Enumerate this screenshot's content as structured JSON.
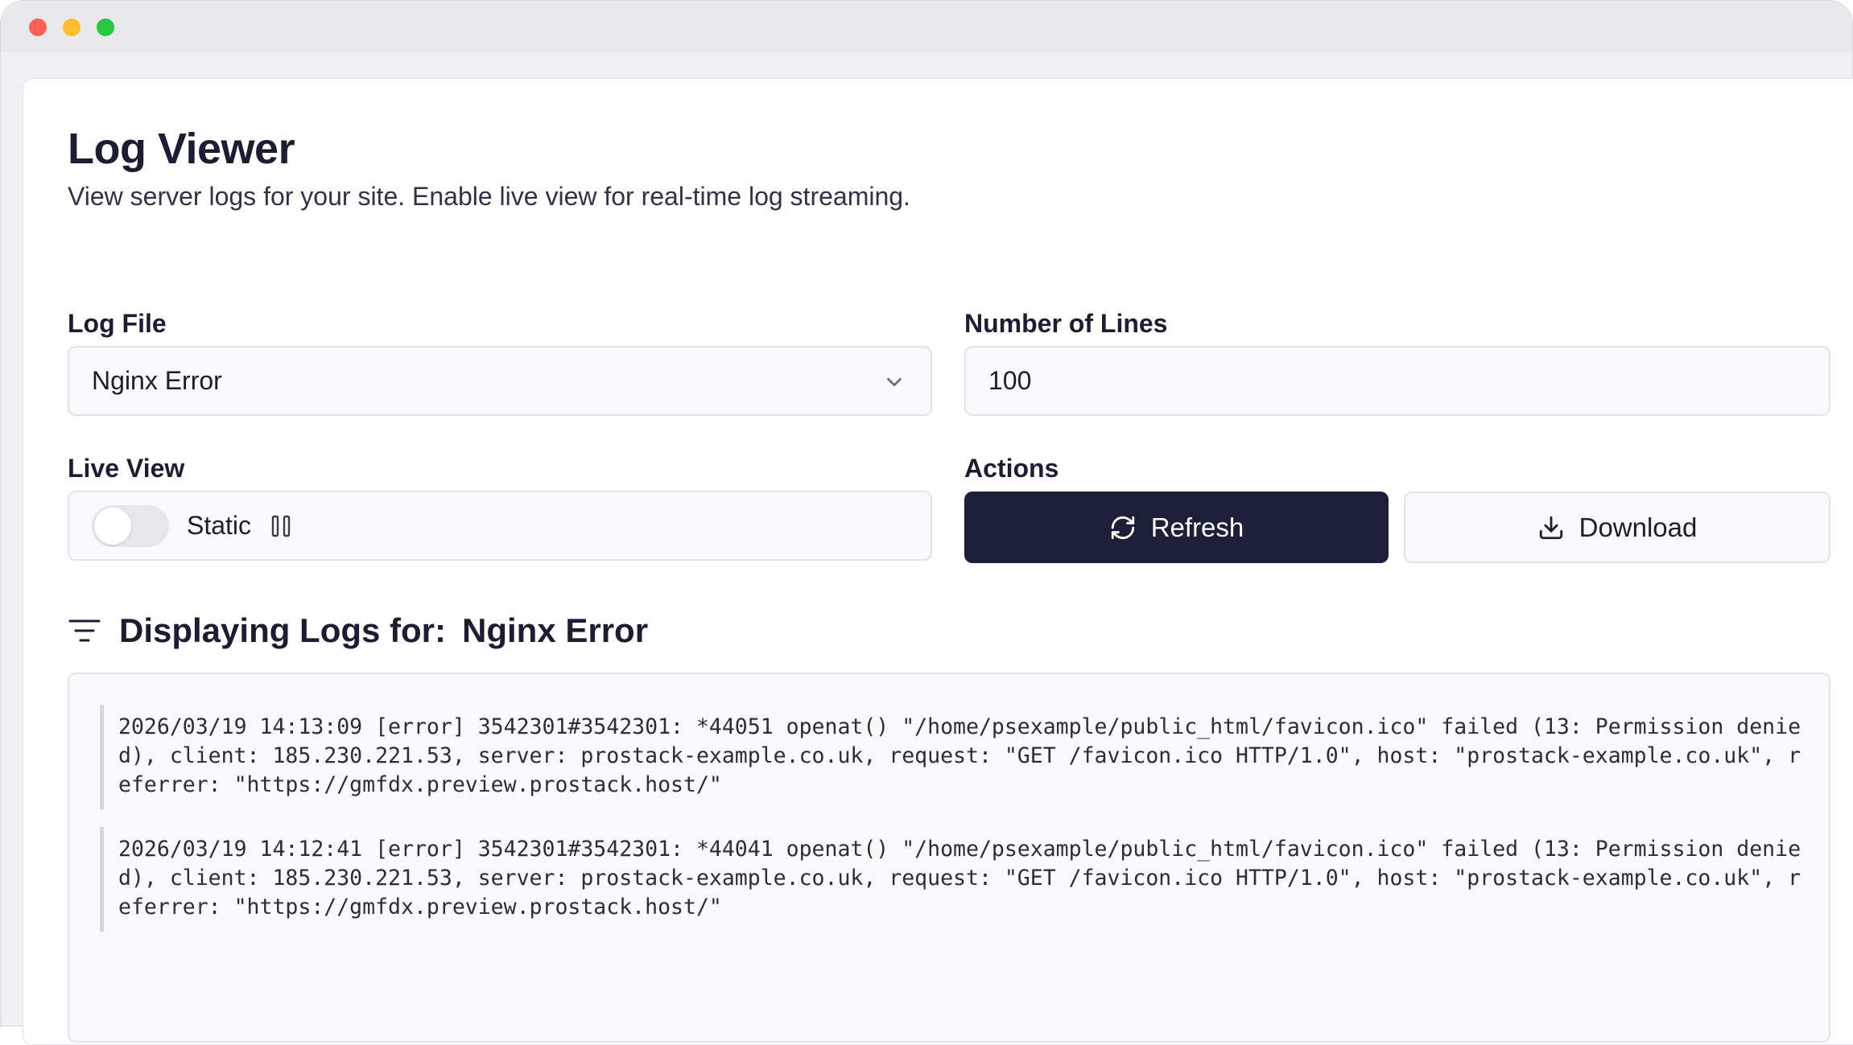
{
  "page": {
    "title": "Log Viewer",
    "subtitle": "View server logs for your site. Enable live view for real-time log streaming."
  },
  "form": {
    "log_file": {
      "label": "Log File",
      "selected": "Nginx Error"
    },
    "lines": {
      "label": "Number of Lines",
      "value": "100"
    },
    "live_view": {
      "label": "Live View",
      "mode_label": "Static",
      "enabled": false
    },
    "actions": {
      "label": "Actions",
      "refresh_label": "Refresh",
      "download_label": "Download"
    }
  },
  "logs": {
    "heading_prefix": "Displaying Logs for:",
    "source": "Nginx Error",
    "entries": [
      "2026/03/19 14:13:09 [error] 3542301#3542301: *44051 openat() \"/home/psexample/public_html/favicon.ico\" failed (13: Permission denied), client: 185.230.221.53, server: prostack-example.co.uk, request: \"GET /favicon.ico HTTP/1.0\", host: \"prostack-example.co.uk\", referrer: \"https://gmfdx.preview.prostack.host/\"",
      "2026/03/19 14:12:41 [error] 3542301#3542301: *44041 openat() \"/home/psexample/public_html/favicon.ico\" failed (13: Permission denied), client: 185.230.221.53, server: prostack-example.co.uk, request: \"GET /favicon.ico HTTP/1.0\", host: \"prostack-example.co.uk\", referrer: \"https://gmfdx.preview.prostack.host/\""
    ]
  },
  "icons": {
    "chevron": "chevron-down-icon",
    "pause": "pause-icon",
    "refresh": "refresh-icon",
    "download": "download-icon",
    "filter": "filter-icon"
  },
  "colors": {
    "primary_button": "#1c1f38",
    "window_close": "#fe5f57",
    "window_minimize": "#febc2e",
    "window_zoom": "#28c840"
  }
}
